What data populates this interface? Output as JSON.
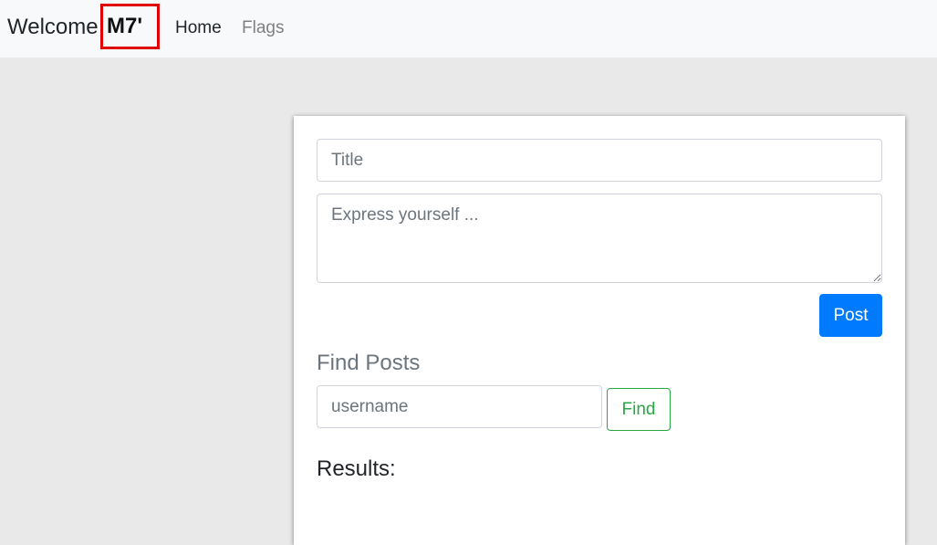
{
  "navbar": {
    "brand_prefix": "Welcome",
    "username": "M7'",
    "links": [
      {
        "label": "Home"
      },
      {
        "label": "Flags"
      }
    ]
  },
  "post_form": {
    "title_placeholder": "Title",
    "body_placeholder": "Express yourself ...",
    "post_button_label": "Post"
  },
  "find_posts": {
    "heading": "Find Posts",
    "username_placeholder": "username",
    "find_button_label": "Find"
  },
  "results": {
    "heading": "Results:"
  },
  "colors": {
    "primary": "#007bff",
    "success": "#28a745",
    "highlight_border": "#e00000",
    "background": "#e9e9e9",
    "navbar_bg": "#f8f9fa"
  }
}
